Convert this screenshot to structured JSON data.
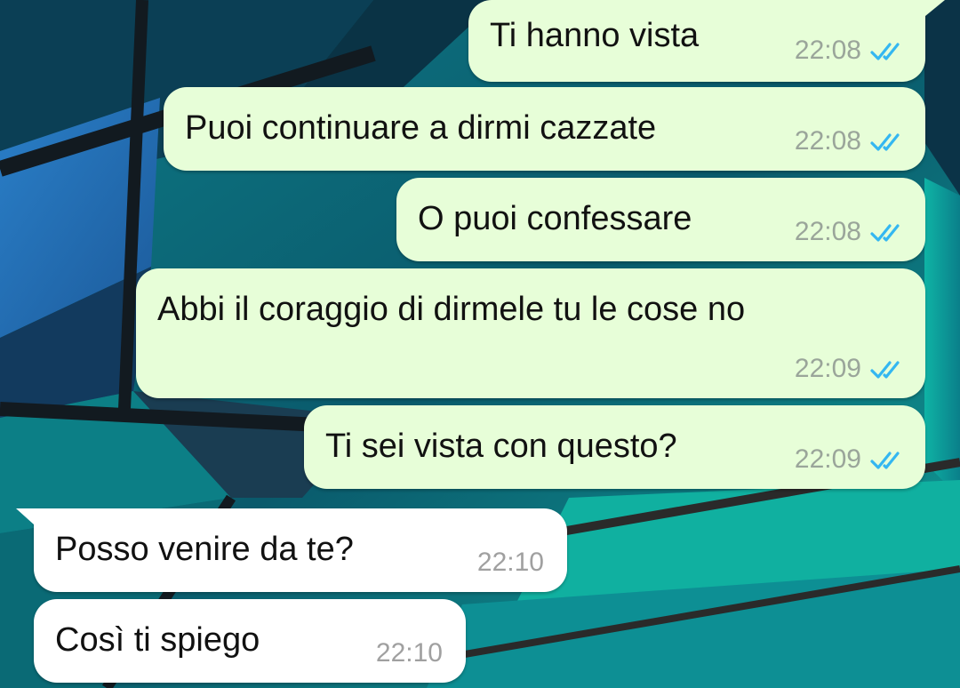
{
  "colors": {
    "outgoing_bubble": "#e7fed8",
    "incoming_bubble": "#ffffff",
    "read_ticks": "#34b7f1",
    "timestamp": "#9aa59a"
  },
  "messages": [
    {
      "direction": "outgoing",
      "text": "Ti hanno vista",
      "time": "22:08",
      "status_icon": "double-check-read-icon"
    },
    {
      "direction": "outgoing",
      "text": "Puoi continuare a dirmi cazzate",
      "time": "22:08",
      "status_icon": "double-check-read-icon"
    },
    {
      "direction": "outgoing",
      "text": "O puoi confessare",
      "time": "22:08",
      "status_icon": "double-check-read-icon"
    },
    {
      "direction": "outgoing",
      "text": "Abbi il coraggio di dirmele tu le cose no",
      "time": "22:09",
      "status_icon": "double-check-read-icon"
    },
    {
      "direction": "outgoing",
      "text": "Ti sei vista con questo?",
      "time": "22:09",
      "status_icon": "double-check-read-icon"
    },
    {
      "direction": "incoming",
      "text": "Posso venire da te?",
      "time": "22:10"
    },
    {
      "direction": "incoming",
      "text": "Così ti spiego",
      "time": "22:10"
    }
  ]
}
